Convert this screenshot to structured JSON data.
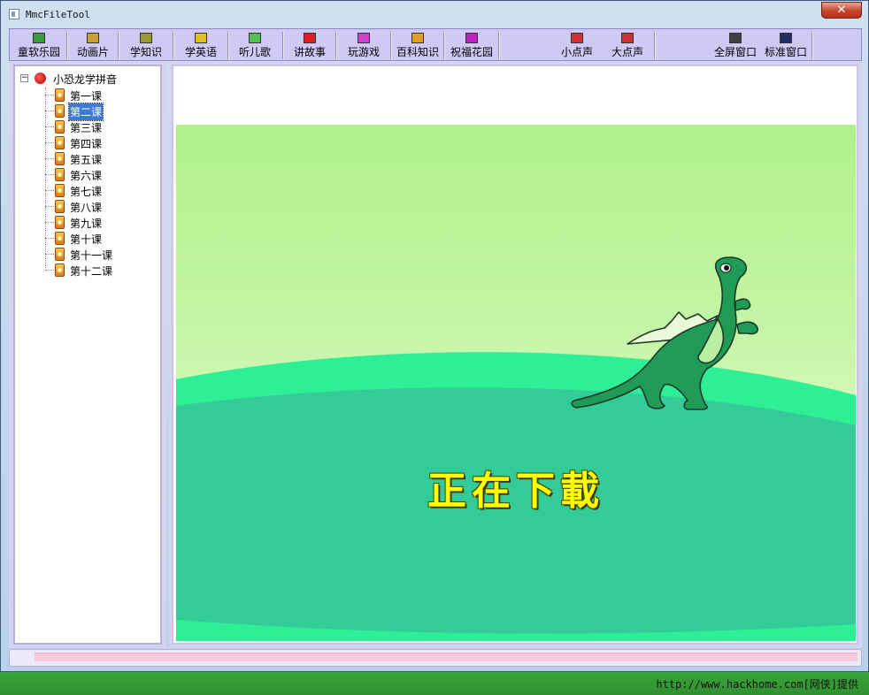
{
  "window": {
    "title": "MmcFileTool",
    "close_label": "✕"
  },
  "toolbar": {
    "buttons": [
      {
        "label": "童软乐园",
        "icon": "face-icon",
        "color": "#3c9a3c"
      },
      {
        "label": "动画片",
        "icon": "burger-icon",
        "color": "#c8a030"
      },
      {
        "label": "学知识",
        "icon": "stack-icon",
        "color": "#9a9a30"
      },
      {
        "label": "学英语",
        "icon": "stack-yellow-icon",
        "color": "#e0c020"
      },
      {
        "label": "听儿歌",
        "icon": "smile-icon",
        "color": "#50c050"
      },
      {
        "label": "讲故事",
        "icon": "red-square-icon",
        "color": "#e02020"
      },
      {
        "label": "玩游戏",
        "icon": "pencil-icon",
        "color": "#d040d0"
      },
      {
        "label": "百科知识",
        "icon": "bear-icon",
        "color": "#e0a020"
      },
      {
        "label": "祝福花园",
        "icon": "flower-icon",
        "color": "#c020c0"
      },
      {
        "label": "小点声",
        "icon": "speaker-low-icon",
        "color": "#d03030"
      },
      {
        "label": "大点声",
        "icon": "speaker-high-icon",
        "color": "#d03030"
      },
      {
        "label": "全屏窗口",
        "icon": "fullscreen-icon",
        "color": "#404040"
      },
      {
        "label": "标准窗口",
        "icon": "window-icon",
        "color": "#203060"
      }
    ]
  },
  "tree": {
    "root_label": "小恐龙学拼音",
    "expand_symbol": "−",
    "selected_index": 1,
    "items": [
      "第一课",
      "第二课",
      "第三课",
      "第四课",
      "第五课",
      "第六课",
      "第七课",
      "第八课",
      "第九课",
      "第十课",
      "第十一课",
      "第十二课"
    ]
  },
  "content": {
    "loading_text": "正在下載"
  },
  "statusbar": {
    "progress": 0
  },
  "desktop": {
    "watermark": "http://www.hackhome.com[网侠]提供"
  }
}
